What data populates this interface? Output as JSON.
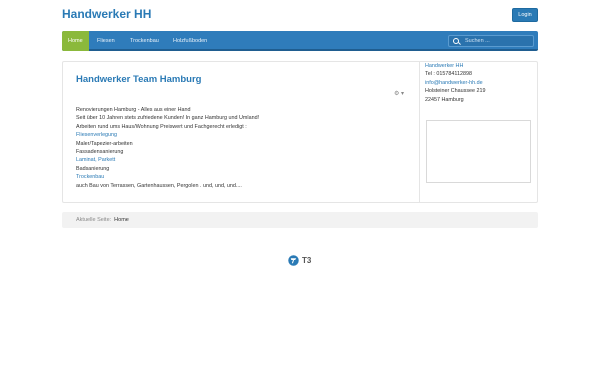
{
  "header": {
    "brand": "Handwerker HH",
    "login_label": "Login"
  },
  "nav": {
    "items": [
      {
        "label": "Home",
        "active": true
      },
      {
        "label": "Fliesen",
        "active": false
      },
      {
        "label": "Trockenbau",
        "active": false
      },
      {
        "label": "Holzfußboden",
        "active": false
      }
    ],
    "search_placeholder": "Suchen ..."
  },
  "content": {
    "title": "Handwerker Team Hamburg",
    "lines": [
      {
        "text": "Renovierungen Hamburg - Alles aus einer Hand",
        "link": false
      },
      {
        "text": "Seit über 10 Jahren stets zufriedene Kunden! In ganz Hamburg und Umland!",
        "link": false
      },
      {
        "text": "Arbeiten rund ums Haus/Wohnung Preiswert und Fachgerecht erledigt :",
        "link": false
      },
      {
        "text": "Fliesenverlegung",
        "link": true
      },
      {
        "text": "Maler/Tapezier-arbeiten",
        "link": false
      },
      {
        "text": "Fassadensanierung",
        "link": false
      },
      {
        "text": "Laminat, Parkett",
        "link": true
      },
      {
        "text": "Badsanierung",
        "link": false
      },
      {
        "text": "Trockenbau",
        "link": true
      },
      {
        "text": "auch Bau von Terrassen, Gartenhaussen, Pergolen . und, und, und....",
        "link": false
      }
    ]
  },
  "sidebar": {
    "lines": [
      {
        "text": "Handwerker HH",
        "link": true
      },
      {
        "text": "Tel : 015784112898",
        "link": false
      },
      {
        "text": "info@handwerker-hh.de",
        "link": true
      },
      {
        "text": "Holsteiner Chaussee 219",
        "link": false
      },
      {
        "text": "22457 Hamburg",
        "link": false
      }
    ]
  },
  "breadcrumb": {
    "label": "Aktuelle Seite:",
    "current": "Home"
  },
  "footer": {
    "logo_text": "T3"
  },
  "colors": {
    "brand_blue": "#2a7ab5",
    "nav_blue": "#2f7cbb",
    "active_green": "#8bb93b"
  }
}
